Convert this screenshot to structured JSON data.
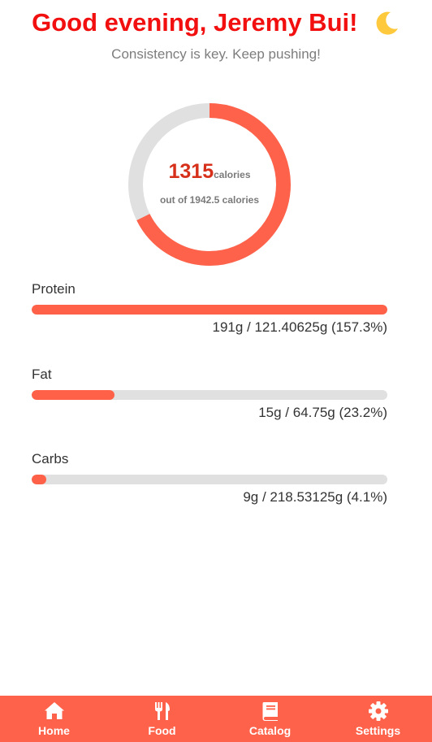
{
  "greeting": {
    "text": "Good evening, Jeremy Bui!",
    "icon": "crescent-moon-icon"
  },
  "subtitle": "Consistency is key. Keep pushing!",
  "calories": {
    "consumed": "1315",
    "unit": "calories",
    "goal_text": "out of 1942.5 calories",
    "progress_fraction": 0.677
  },
  "macros": [
    {
      "label": "Protein",
      "value_text": "191g / 121.40625g (157.3%)",
      "percent": 157.3
    },
    {
      "label": "Fat",
      "value_text": "15g / 64.75g (23.2%)",
      "percent": 23.2
    },
    {
      "label": "Carbs",
      "value_text": "9g / 218.53125g (4.1%)",
      "percent": 4.1
    }
  ],
  "nav": [
    {
      "label": "Home",
      "icon": "home-icon"
    },
    {
      "label": "Food",
      "icon": "fork-knife-icon"
    },
    {
      "label": "Catalog",
      "icon": "book-icon"
    },
    {
      "label": "Settings",
      "icon": "gear-icon"
    }
  ],
  "colors": {
    "accent": "#ff624a",
    "greeting": "#f20f0f",
    "calorie_number": "#d6301a",
    "track": "#e0e0e0"
  }
}
